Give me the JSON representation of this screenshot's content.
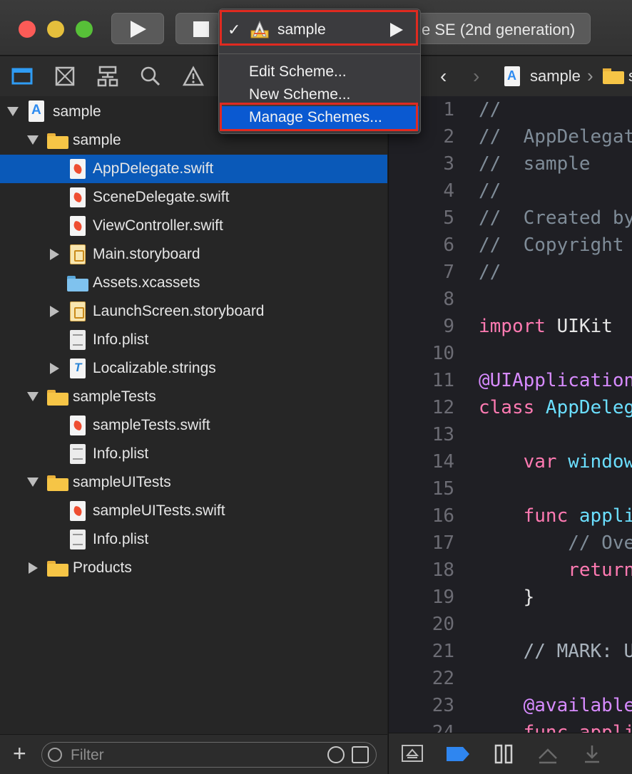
{
  "window": {
    "destination": "e SE (2nd generation)"
  },
  "scheme_menu": {
    "current_scheme": "sample",
    "checkmark": "✓",
    "items": [
      {
        "label": "Edit Scheme..."
      },
      {
        "label": "New Scheme..."
      },
      {
        "label": "Manage Schemes..."
      }
    ],
    "highlighted_item": "Manage Schemes...",
    "callout_color": "#e02a20"
  },
  "navigator": {
    "toolbar_icons": [
      "folder-icon",
      "source-control-icon",
      "hierarchy-icon",
      "find-icon",
      "issue-warning-icon"
    ],
    "tree": [
      {
        "label": "sample",
        "icon": "project-icon",
        "disclosure": "open"
      },
      {
        "label": "sample",
        "icon": "folder-icon",
        "disclosure": "open"
      },
      {
        "label": "AppDelegate.swift",
        "icon": "swift-file-icon",
        "selected": true
      },
      {
        "label": "SceneDelegate.swift",
        "icon": "swift-file-icon"
      },
      {
        "label": "ViewController.swift",
        "icon": "swift-file-icon"
      },
      {
        "label": "Main.storyboard",
        "icon": "storyboard-file-icon",
        "disclosure": "closed"
      },
      {
        "label": "Assets.xcassets",
        "icon": "assets-folder-icon"
      },
      {
        "label": "LaunchScreen.storyboard",
        "icon": "storyboard-file-icon",
        "disclosure": "closed"
      },
      {
        "label": "Info.plist",
        "icon": "plist-file-icon"
      },
      {
        "label": "Localizable.strings",
        "icon": "strings-file-icon",
        "disclosure": "closed"
      },
      {
        "label": "sampleTests",
        "icon": "folder-icon",
        "disclosure": "open"
      },
      {
        "label": "sampleTests.swift",
        "icon": "swift-file-icon"
      },
      {
        "label": "Info.plist",
        "icon": "plist-file-icon"
      },
      {
        "label": "sampleUITests",
        "icon": "folder-icon",
        "disclosure": "open"
      },
      {
        "label": "sampleUITests.swift",
        "icon": "swift-file-icon"
      },
      {
        "label": "Info.plist",
        "icon": "plist-file-icon"
      },
      {
        "label": "Products",
        "icon": "folder-icon",
        "disclosure": "closed"
      }
    ],
    "filter_placeholder": "Filter",
    "add_label": "+"
  },
  "jump_bar": {
    "back": "‹",
    "forward": "›",
    "project": "sample",
    "separator": "›",
    "tail": "s"
  },
  "editor": {
    "lines": [
      {
        "n": "1",
        "text": "//",
        "kind": "comment"
      },
      {
        "n": "2",
        "text": "//  AppDelegat",
        "kind": "comment"
      },
      {
        "n": "3",
        "text": "//  sample",
        "kind": "comment"
      },
      {
        "n": "4",
        "text": "//",
        "kind": "comment"
      },
      {
        "n": "5",
        "text": "//  Created by",
        "kind": "comment"
      },
      {
        "n": "6",
        "text": "//  Copyright",
        "kind": "comment"
      },
      {
        "n": "7",
        "text": "//",
        "kind": "comment"
      },
      {
        "n": "8",
        "text": "",
        "kind": "plain"
      },
      {
        "n": "9",
        "text": "import",
        "rest": " UIKit",
        "kind": "keyword"
      },
      {
        "n": "10",
        "text": "",
        "kind": "plain"
      },
      {
        "n": "11",
        "text": "@UIApplication",
        "kind": "attr"
      },
      {
        "n": "12",
        "text": "class",
        "rest": " AppDeleg",
        "kind": "keyword-type"
      },
      {
        "n": "13",
        "text": "",
        "kind": "plain"
      },
      {
        "n": "14",
        "text": "    var",
        "rest": " window",
        "kind": "keyword-type"
      },
      {
        "n": "15",
        "text": "",
        "kind": "plain"
      },
      {
        "n": "16",
        "text": "    func",
        "rest": " appli",
        "kind": "keyword-type"
      },
      {
        "n": "17",
        "text": "        // Ove",
        "kind": "comment"
      },
      {
        "n": "18",
        "text": "        return",
        "kind": "keyword"
      },
      {
        "n": "19",
        "text": "    }",
        "kind": "plain"
      },
      {
        "n": "20",
        "text": "",
        "kind": "plain"
      },
      {
        "n": "21",
        "text": "    // MARK: U",
        "kind": "mark"
      },
      {
        "n": "22",
        "text": "",
        "kind": "plain"
      },
      {
        "n": "23",
        "text": "    @available",
        "kind": "attr"
      },
      {
        "n": "24",
        "text": "    func appli",
        "kind": "keyword"
      }
    ]
  },
  "colors": {
    "selection": "#0a59b8",
    "menu_highlight": "#0a59d1",
    "close": "#fc5b57",
    "minimize": "#e5bf3c",
    "maximize": "#57c038"
  }
}
